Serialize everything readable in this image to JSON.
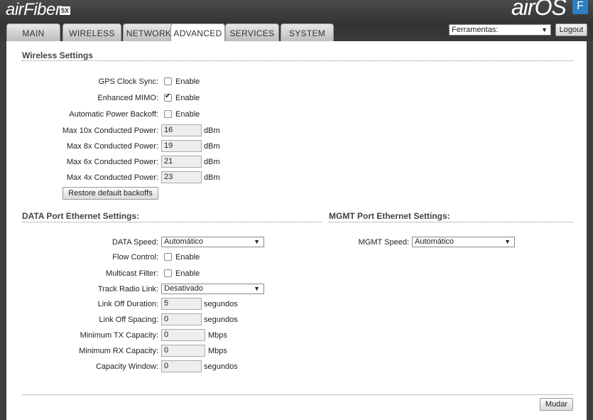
{
  "header": {
    "brand": "airFiber",
    "brand_badge": "5X",
    "os_title": "airOS",
    "os_badge": "F",
    "tools_select": "Ferramentas:",
    "logout_label": "Logout"
  },
  "tabs": [
    {
      "label": "MAIN"
    },
    {
      "label": "WIRELESS"
    },
    {
      "label": "NETWORK"
    },
    {
      "label": "ADVANCED"
    },
    {
      "label": "SERVICES"
    },
    {
      "label": "SYSTEM"
    }
  ],
  "active_tab": "ADVANCED",
  "wireless": {
    "title": "Wireless Settings",
    "gps_label": "GPS Clock Sync:",
    "gps_checked": false,
    "mimo_label": "Enhanced MIMO:",
    "mimo_checked": true,
    "backoff_label": "Automatic Power Backoff:",
    "backoff_checked": false,
    "enable_label": "Enable",
    "p10_label": "Max 10x Conducted Power:",
    "p10_value": "16",
    "p8_label": "Max 8x Conducted Power:",
    "p8_value": "19",
    "p6_label": "Max 6x Conducted Power:",
    "p6_value": "21",
    "p4_label": "Max 4x Conducted Power:",
    "p4_value": "23",
    "power_unit": "dBm",
    "restore_label": "Restore default backoffs"
  },
  "data_port": {
    "title": "DATA Port Ethernet Settings:",
    "speed_label": "DATA Speed:",
    "speed_value": "Automático",
    "flow_label": "Flow Control:",
    "flow_checked": false,
    "multicast_label": "Multicast Filter:",
    "multicast_checked": false,
    "enable_label": "Enable",
    "track_label": "Track Radio Link:",
    "track_value": "Desativado",
    "off_duration_label": "Link Off Duration:",
    "off_duration_value": "5",
    "off_spacing_label": "Link Off Spacing:",
    "off_spacing_value": "0",
    "min_tx_label": "Minimum TX Capacity:",
    "min_tx_value": "0",
    "min_rx_label": "Minimum RX Capacity:",
    "min_rx_value": "0",
    "cap_window_label": "Capacity Window:",
    "cap_window_value": "0",
    "seconds_unit": "segundos",
    "mbps_unit": "Mbps"
  },
  "mgmt_port": {
    "title": "MGMT Port Ethernet Settings:",
    "speed_label": "MGMT Speed:",
    "speed_value": "Automático"
  },
  "footer": {
    "save_label": "Mudar"
  }
}
